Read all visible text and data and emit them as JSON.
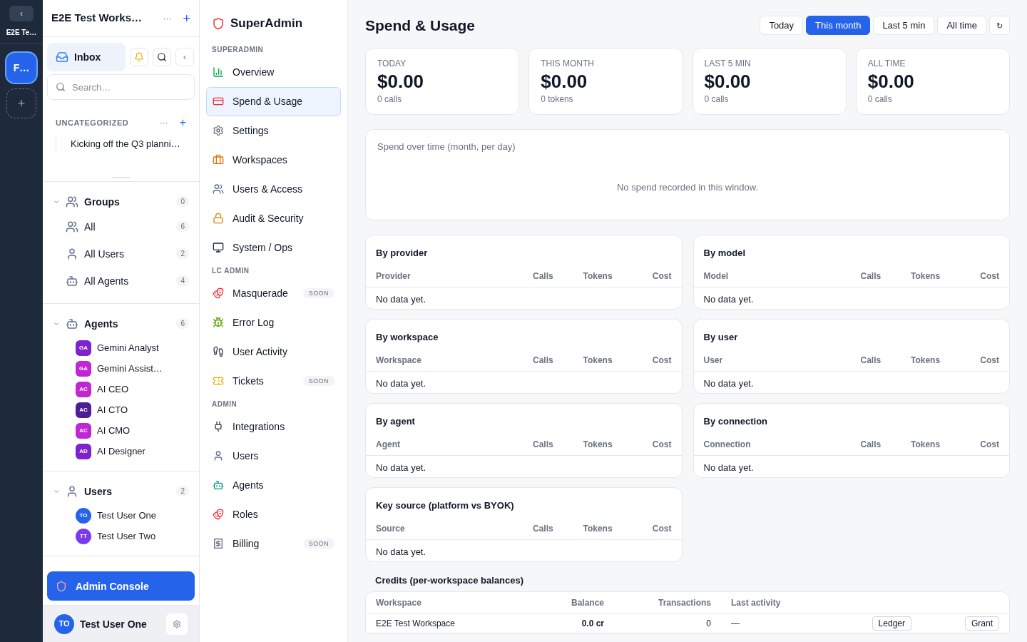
{
  "rail": {
    "collapse": "‹",
    "workspace_label": "E2E Te…",
    "workspaces": [
      {
        "label": "F…",
        "selected": true
      }
    ],
    "add": "+"
  },
  "sidebar": {
    "title": "E2E Test Works…",
    "more": "···",
    "add": "+",
    "inbox": {
      "label": "Inbox",
      "selected": true
    },
    "collapse": "‹",
    "search": {
      "placeholder": "Search…"
    },
    "uncategorized": {
      "title": "UNCATEGORIZED",
      "more": "···",
      "add": "+",
      "items": [
        "Kicking off the Q3 planni…"
      ]
    },
    "sections": [
      {
        "title": "Groups",
        "count": "0",
        "expanded": true,
        "kind": "groups",
        "items": [
          {
            "label": "All",
            "count": "6"
          },
          {
            "label": "All Users",
            "count": "2"
          },
          {
            "label": "All Agents",
            "count": "4"
          }
        ]
      },
      {
        "title": "Agents",
        "count": "6",
        "expanded": true,
        "kind": "agents",
        "items": [
          {
            "initials": "GA",
            "label": "Gemini Analyst",
            "color": "#7e22ce"
          },
          {
            "initials": "GA",
            "label": "Gemini Assist…",
            "color": "#c026d3"
          },
          {
            "initials": "AC",
            "label": "AI CEO",
            "color": "#c026d3"
          },
          {
            "initials": "AC",
            "label": "AI CTO",
            "color": "#4c1d95"
          },
          {
            "initials": "AC",
            "label": "AI CMO",
            "color": "#c026d3"
          },
          {
            "initials": "AD",
            "label": "AI Designer",
            "color": "#7e22ce"
          }
        ]
      },
      {
        "title": "Users",
        "count": "2",
        "expanded": true,
        "kind": "users",
        "items": [
          {
            "initials": "TO",
            "label": "Test User One",
            "color": "#2563eb"
          },
          {
            "initials": "TT",
            "label": "Test User Two",
            "color": "#7c3aed"
          }
        ]
      }
    ],
    "admin_console": "Admin Console",
    "user": {
      "initials": "TO",
      "name": "Test User One"
    }
  },
  "admin_nav": {
    "title": "SuperAdmin",
    "groups": [
      {
        "title": "SUPERADMIN",
        "items": [
          {
            "label": "Overview",
            "selected": false
          },
          {
            "label": "Spend & Usage",
            "selected": true
          },
          {
            "label": "Settings",
            "selected": false
          },
          {
            "label": "Workspaces",
            "selected": false
          },
          {
            "label": "Users & Access",
            "selected": false
          },
          {
            "label": "Audit & Security",
            "selected": false
          },
          {
            "label": "System / Ops",
            "selected": false
          }
        ]
      },
      {
        "title": "LC ADMIN",
        "items": [
          {
            "label": "Masquerade",
            "selected": false,
            "badge": "SOON"
          },
          {
            "label": "Error Log",
            "selected": false
          },
          {
            "label": "User Activity",
            "selected": false
          },
          {
            "label": "Tickets",
            "selected": false,
            "badge": "SOON"
          }
        ]
      },
      {
        "title": "ADMIN",
        "items": [
          {
            "label": "Integrations",
            "selected": false
          },
          {
            "label": "Users",
            "selected": false
          },
          {
            "label": "Agents",
            "selected": false
          },
          {
            "label": "Roles",
            "selected": false
          },
          {
            "label": "Billing",
            "selected": false,
            "badge": "SOON"
          }
        ]
      }
    ]
  },
  "main": {
    "title": "Spend & Usage",
    "ranges": [
      {
        "label": "Today",
        "selected": false
      },
      {
        "label": "This month",
        "selected": true
      },
      {
        "label": "Last 5 min",
        "selected": false
      },
      {
        "label": "All time",
        "selected": false
      }
    ],
    "refresh": "↻",
    "stats": [
      {
        "label": "TODAY",
        "value": "$0.00",
        "sub": "0 calls"
      },
      {
        "label": "THIS MONTH",
        "value": "$0.00",
        "sub": "0 tokens"
      },
      {
        "label": "LAST 5 MIN",
        "value": "$0.00",
        "sub": "0 calls"
      },
      {
        "label": "ALL TIME",
        "value": "$0.00",
        "sub": "0 calls"
      }
    ],
    "chart": {
      "title": "Spend over time (month, per day)",
      "empty": "No spend recorded in this window."
    },
    "breakdowns": [
      {
        "title": "By provider",
        "columns": [
          "Provider",
          "Calls",
          "Tokens",
          "Cost"
        ],
        "empty": "No data yet."
      },
      {
        "title": "By model",
        "columns": [
          "Model",
          "Calls",
          "Tokens",
          "Cost"
        ],
        "empty": "No data yet."
      },
      {
        "title": "By workspace",
        "columns": [
          "Workspace",
          "Calls",
          "Tokens",
          "Cost"
        ],
        "empty": "No data yet."
      },
      {
        "title": "By user",
        "columns": [
          "User",
          "Calls",
          "Tokens",
          "Cost"
        ],
        "empty": "No data yet."
      },
      {
        "title": "By agent",
        "columns": [
          "Agent",
          "Calls",
          "Tokens",
          "Cost"
        ],
        "empty": "No data yet."
      },
      {
        "title": "By connection",
        "columns": [
          "Connection",
          "Calls",
          "Tokens",
          "Cost"
        ],
        "empty": "No data yet."
      },
      {
        "title": "Key source (platform vs BYOK)",
        "columns": [
          "Source",
          "Calls",
          "Tokens",
          "Cost"
        ],
        "empty": "No data yet."
      }
    ],
    "credits": {
      "title": "Credits (per-workspace balances)",
      "columns": [
        "Workspace",
        "Balance",
        "Transactions",
        "Last activity"
      ],
      "rows": [
        {
          "workspace": "E2E Test Workspace",
          "balance": "0.0 cr",
          "transactions": "0",
          "last_activity": "—",
          "actions": [
            "Ledger",
            "Grant"
          ]
        }
      ]
    }
  }
}
